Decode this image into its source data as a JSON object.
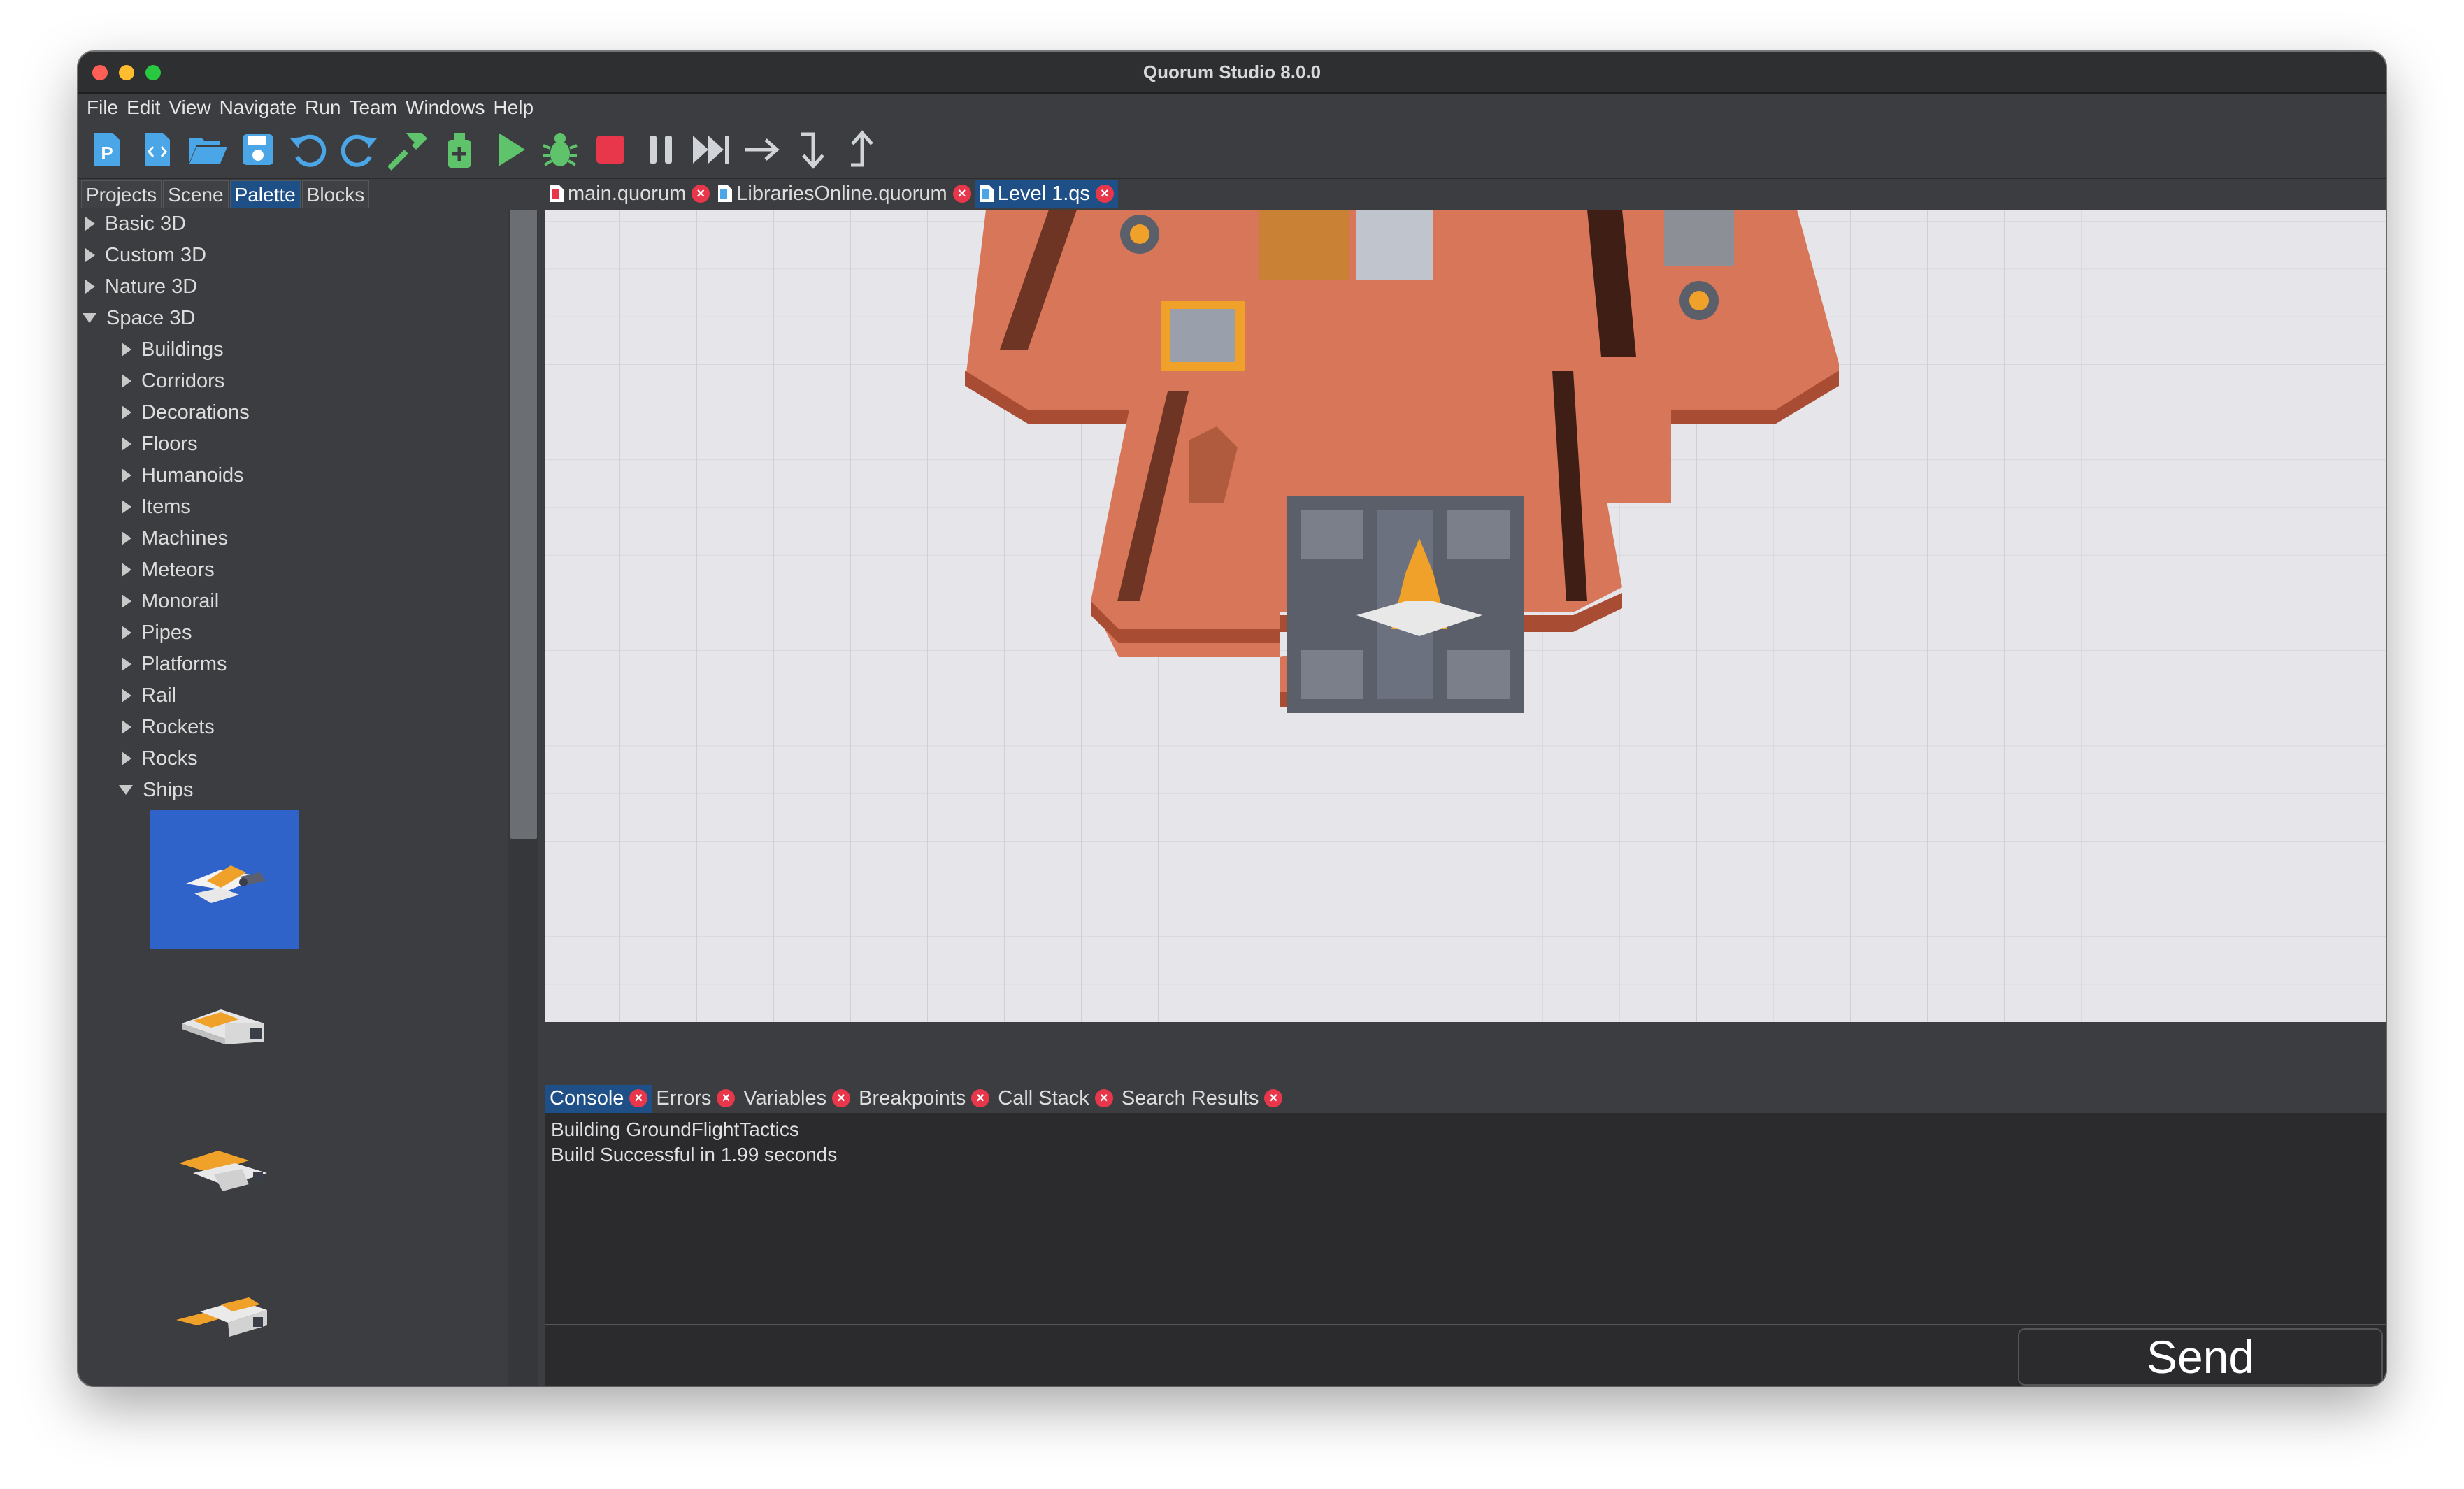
{
  "window": {
    "title": "Quorum Studio 8.0.0"
  },
  "menubar": [
    "File",
    "Edit",
    "View",
    "Navigate",
    "Run",
    "Team",
    "Windows",
    "Help"
  ],
  "toolbar": {
    "buttons": [
      "new-project-icon",
      "new-file-icon",
      "open-folder-icon",
      "save-icon",
      "undo-icon",
      "redo-icon",
      "build-hammer-icon",
      "clean-build-icon",
      "run-play-icon",
      "debug-bug-icon",
      "stop-icon",
      "pause-icon",
      "fast-forward-icon",
      "step-over-icon",
      "step-into-icon",
      "step-out-icon"
    ],
    "accent_green": "#5fc36b",
    "accent_blue": "#4aa6e6",
    "stop_red": "#e8374b"
  },
  "left_tabs": [
    {
      "label": "Projects",
      "active": false
    },
    {
      "label": "Scene",
      "active": false
    },
    {
      "label": "Palette",
      "active": true
    },
    {
      "label": "Blocks",
      "active": false
    }
  ],
  "palette": {
    "categories": [
      {
        "label": "Basic 3D",
        "expanded": false
      },
      {
        "label": "Custom 3D",
        "expanded": false
      },
      {
        "label": "Nature 3D",
        "expanded": false
      },
      {
        "label": "Space 3D",
        "expanded": true
      }
    ],
    "space_children": [
      {
        "label": "Buildings",
        "expanded": false
      },
      {
        "label": "Corridors",
        "expanded": false
      },
      {
        "label": "Decorations",
        "expanded": false
      },
      {
        "label": "Floors",
        "expanded": false
      },
      {
        "label": "Humanoids",
        "expanded": false
      },
      {
        "label": "Items",
        "expanded": false
      },
      {
        "label": "Machines",
        "expanded": false
      },
      {
        "label": "Meteors",
        "expanded": false
      },
      {
        "label": "Monorail",
        "expanded": false
      },
      {
        "label": "Pipes",
        "expanded": false
      },
      {
        "label": "Platforms",
        "expanded": false
      },
      {
        "label": "Rail",
        "expanded": false
      },
      {
        "label": "Rockets",
        "expanded": false
      },
      {
        "label": "Rocks",
        "expanded": false
      },
      {
        "label": "Ships",
        "expanded": true
      }
    ],
    "ship_thumbnails": [
      "ship-1",
      "ship-2",
      "ship-3",
      "ship-4"
    ],
    "selected_thumbnail": "ship-1"
  },
  "editor_tabs": [
    {
      "label": "main.quorum",
      "active": false
    },
    {
      "label": "LibrariesOnline.quorum",
      "active": false
    },
    {
      "label": "Level 1.qs",
      "active": true
    }
  ],
  "console_tabs": [
    {
      "label": "Console",
      "active": true
    },
    {
      "label": "Errors",
      "active": false
    },
    {
      "label": "Variables",
      "active": false
    },
    {
      "label": "Breakpoints",
      "active": false
    },
    {
      "label": "Call Stack",
      "active": false
    },
    {
      "label": "Search Results",
      "active": false
    }
  ],
  "console_output": [
    "Building GroundFlightTactics",
    "Build Successful in 1.99 seconds"
  ],
  "console_input": {
    "value": ""
  },
  "send_button": "Send"
}
